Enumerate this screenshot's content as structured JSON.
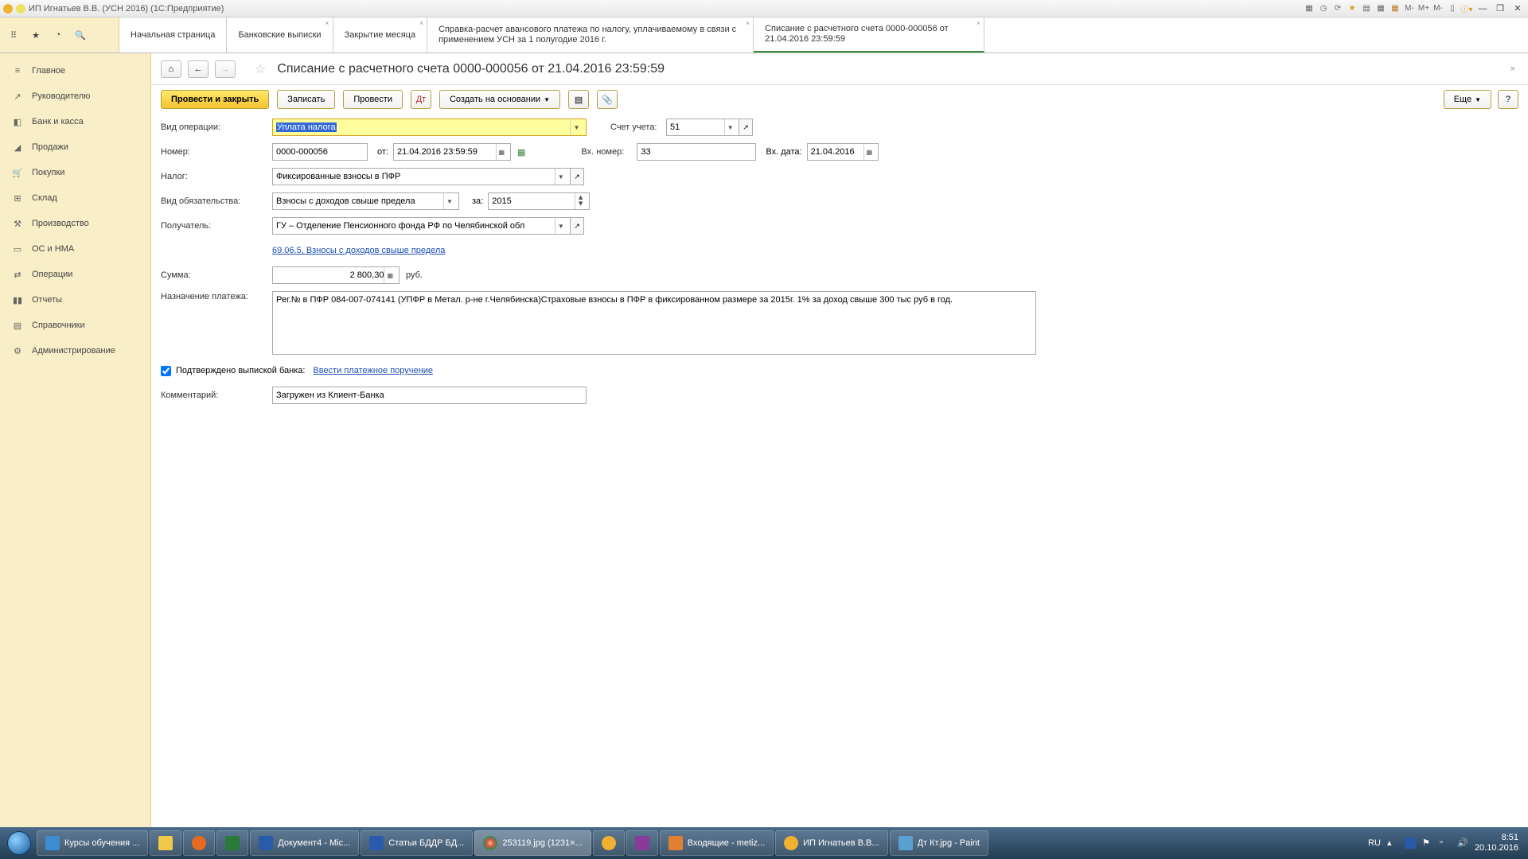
{
  "titlebar": {
    "title": "ИП Игнатьев В.В. (УСН 2016)  (1С:Предприятие)"
  },
  "tabs": [
    {
      "label": "Начальная страница"
    },
    {
      "label": "Банковские выписки"
    },
    {
      "label": "Закрытие месяца"
    },
    {
      "label": "Справка-расчет авансового платежа по налогу, уплачиваемому в связи с применением УСН за 1 полугодие 2016 г."
    },
    {
      "label": "Списание с расчетного счета 0000-000056 от 21.04.2016 23:59:59"
    }
  ],
  "sidebar": {
    "items": [
      {
        "label": "Главное"
      },
      {
        "label": "Руководителю"
      },
      {
        "label": "Банк и касса"
      },
      {
        "label": "Продажи"
      },
      {
        "label": "Покупки"
      },
      {
        "label": "Склад"
      },
      {
        "label": "Производство"
      },
      {
        "label": "ОС и НМА"
      },
      {
        "label": "Операции"
      },
      {
        "label": "Отчеты"
      },
      {
        "label": "Справочники"
      },
      {
        "label": "Администрирование"
      }
    ]
  },
  "page": {
    "title": "Списание с расчетного счета 0000-000056 от 21.04.2016 23:59:59"
  },
  "cmd": {
    "post_close": "Провести и закрыть",
    "save": "Записать",
    "post": "Провести",
    "create_based": "Создать на основании",
    "more": "Еще"
  },
  "labels": {
    "op_type": "Вид операции:",
    "account": "Счет учета:",
    "number": "Номер:",
    "from": "от:",
    "in_number": "Вх. номер:",
    "in_date": "Вх. дата:",
    "tax": "Налог:",
    "obligation": "Вид обязательства:",
    "for": "за:",
    "payee": "Получатель:",
    "sum": "Сумма:",
    "rub": "руб.",
    "purpose": "Назначение платежа:",
    "confirmed": "Подтверждено выпиской банка:",
    "enter_payment": "Ввести платежное поручение",
    "comment": "Комментарий:",
    "link_6906": "69.06.5, Взносы с доходов свыше предела"
  },
  "values": {
    "op_type": "Уплата налога",
    "account": "51",
    "number": "0000-000056",
    "date": "21.04.2016 23:59:59",
    "in_number": "33",
    "in_date": "21.04.2016",
    "tax": "Фиксированные взносы в ПФР",
    "obligation": "Взносы с доходов свыше предела",
    "year": "2015",
    "payee": "ГУ – Отделение Пенсионного фонда РФ по Челябинской обл",
    "sum": "2 800,30",
    "purpose": "Рег.№ в ПФР 084-007-074141 (УПФР в Метал. р-не г.Челябинска)Страховые взносы в ПФР в фиксированном размере за 2015г. 1% за доход свыше 300 тыс руб в год.",
    "comment": "Загружен из Клиент-Банка"
  },
  "taskbar": {
    "items": [
      {
        "label": "Курсы обучения ...",
        "color": "#3b8dd0"
      },
      {
        "label": "",
        "color": "#f0c94a"
      },
      {
        "label": "",
        "color": "#e66a1e"
      },
      {
        "label": "",
        "color": "#2a7a3a"
      },
      {
        "label": "Документ4 - Mic...",
        "color": "#2a5aaa"
      },
      {
        "label": "Статьи БДДР БД...",
        "color": "#2a5aaa"
      },
      {
        "label": "253119.jpg (1231×...",
        "color": "#d9534f"
      },
      {
        "label": "",
        "color": "#f0b030"
      },
      {
        "label": "",
        "color": "#8a3a9a"
      },
      {
        "label": "Входящие - metiz...",
        "color": "#e08030"
      },
      {
        "label": "ИП Игнатьев В.В...",
        "color": "#f0b030"
      },
      {
        "label": "Дт Кт.jpg - Paint",
        "color": "#5aa0d0"
      }
    ],
    "lang": "RU",
    "time": "8:51",
    "date": "20.10.2016"
  }
}
